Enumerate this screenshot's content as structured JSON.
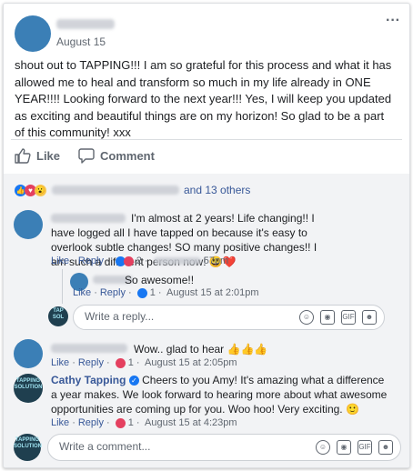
{
  "post": {
    "date": "August 15",
    "text": "shout out to TAPPING!!! I am so grateful for this process and what it has allowed me to heal and transform so much in my life already in ONE YEAR!!!! Looking forward to the next year!!! Yes, I will keep you updated as exciting and beautiful things are on my horizon! So glad to be a part of this community! xxx",
    "more_label": "···"
  },
  "actions": {
    "like_label": "Like",
    "comment_label": "Comment"
  },
  "reactions": {
    "others_label": "and 13 others"
  },
  "comments": [
    {
      "text": "I'm almost at 2 years! Life changing!! I have logged all I have tapped on because it's easy to overlook subtle changes! SO many positive changes!! I am such a different person now! 😃❤️",
      "like_label": "Like",
      "reply_label": "Reply",
      "reaction_count": "2",
      "time": "57pm",
      "replies": [
        {
          "text": "So awesome!!",
          "like_label": "Like",
          "reply_label": "Reply",
          "reaction_count": "1",
          "time": "August 15 at 2:01pm"
        }
      ],
      "reply_placeholder": "Write a reply..."
    },
    {
      "text": "Wow.. glad to hear 👍👍👍",
      "like_label": "Like",
      "reply_label": "Reply",
      "reaction_count": "1",
      "time": "August 15 at 2:05pm"
    },
    {
      "author": "Cathy Tapping",
      "text": "Cheers to you Amy! It's amazing what a difference a year makes. We look forward to hearing more about what awesome opportunities are coming up for you. Woo hoo! Very exciting. 🙂",
      "like_label": "Like",
      "reply_label": "Reply",
      "reaction_count": "1",
      "time": "August 15 at 4:23pm"
    }
  ],
  "brand_logo_text": "The Tapping Solution",
  "comment_input": {
    "placeholder": "Write a comment..."
  },
  "colors": {
    "link": "#385898",
    "like_blue": "#1877f2",
    "love_red": "#e4405f",
    "avatar_blue": "#3b7fb6"
  },
  "icons": [
    "more-icon",
    "like-thumb-icon",
    "comment-bubble-icon",
    "emoji-icon",
    "camera-icon",
    "gif-icon",
    "sticker-icon",
    "verified-badge-icon"
  ]
}
